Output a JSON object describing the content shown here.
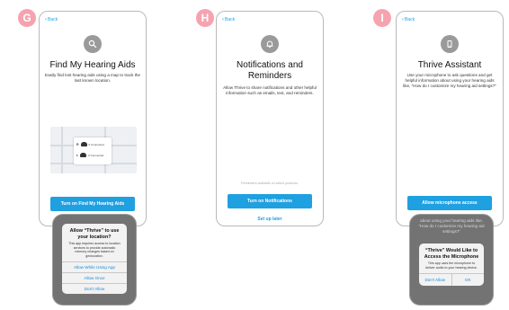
{
  "colors": {
    "accent": "#1fa0e0",
    "badge": "#f6a3b0"
  },
  "screens": [
    {
      "badge": "G",
      "back": "Back",
      "icon": "search-icon",
      "title": "Find My Hearing Aids",
      "description": "Easily find lost hearing aids using a map to track the last known location.",
      "map": {
        "rows": [
          {
            "side": "R",
            "label": "0 Connected"
          },
          {
            "side": "L",
            "label": "0 Connected"
          }
        ]
      },
      "button": "Turn on Find My Hearing Aids",
      "zoom": {
        "background": "",
        "dialog_title": "Allow “Thrive” to use your location?",
        "dialog_body": "This app requires access to location services to provide automatic memory changes based on geolocation.",
        "actions": [
          "Allow While Using App",
          "Allow Once",
          "Don't Allow"
        ]
      }
    },
    {
      "badge": "H",
      "back": "Back",
      "icon": "bell-icon",
      "title": "Notifications and Reminders",
      "description": "Allow Thrive to share notifications and other helpful information such as emails, text, and reminders.",
      "note": "Reminders available on select products.",
      "button": "Turn on Notifications",
      "link": "Set up later"
    },
    {
      "badge": "I",
      "back": "Back",
      "icon": "phone-icon",
      "title": "Thrive Assistant",
      "description": "Use your microphone to ask questions and get helpful information about using your hearing aids like, “How do I customize my hearing aid settings?”",
      "button": "Allow microphone access",
      "zoom": {
        "background": "about using your hearing aids like, “How do I customize my hearing aid settings?”",
        "dialog_title": "“Thrive” Would Like to Access the Microphone",
        "dialog_body": "This app uses the microphone to deliver audio to your hearing device.",
        "actions": [
          "Don't Allow",
          "OK"
        ]
      }
    }
  ]
}
